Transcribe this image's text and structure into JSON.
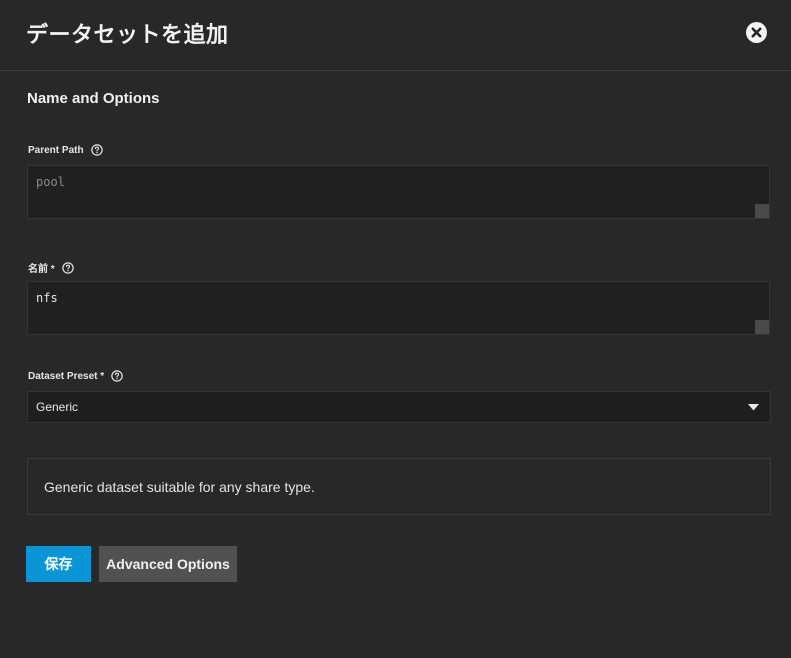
{
  "dialog": {
    "title": "データセットを追加"
  },
  "section": {
    "title": "Name and Options"
  },
  "fields": {
    "parent_path": {
      "label": "Parent Path",
      "value": "pool",
      "icon": "help-circle-icon"
    },
    "name": {
      "label": "名前 *",
      "value": "nfs",
      "icon": "help-circle-icon"
    },
    "dataset_preset": {
      "label": "Dataset Preset *",
      "selected": "Generic",
      "icon": "help-circle-icon"
    }
  },
  "preset_description": "Generic dataset suitable for any share type.",
  "buttons": {
    "save_label": "保存",
    "advanced_label": "Advanced Options"
  },
  "colors": {
    "background": "#282828",
    "primary": "#0a95d6",
    "secondary_button": "#515151"
  }
}
